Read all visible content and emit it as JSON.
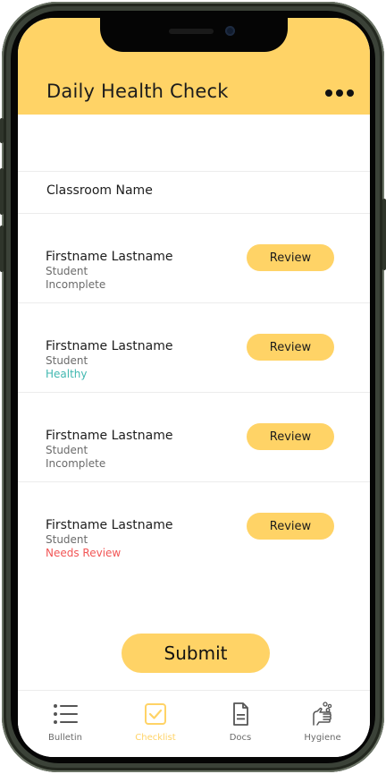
{
  "header": {
    "title": "Daily Health Check"
  },
  "classroom": {
    "name": "Classroom Name"
  },
  "students": [
    {
      "name": "Firstname Lastname",
      "role": "Student",
      "status": "Incomplete",
      "review_label": "Review"
    },
    {
      "name": "Firstname Lastname",
      "role": "Student",
      "status": "Healthy",
      "review_label": "Review"
    },
    {
      "name": "Firstname Lastname",
      "role": "Student",
      "status": "Incomplete",
      "review_label": "Review"
    },
    {
      "name": "Firstname Lastname",
      "role": "Student",
      "status": "Needs Review",
      "review_label": "Review"
    }
  ],
  "submit_label": "Submit",
  "tabs": [
    {
      "label": "Bulletin",
      "icon": "list-icon",
      "active": false
    },
    {
      "label": "Checklist",
      "icon": "checkbox-icon",
      "active": true
    },
    {
      "label": "Docs",
      "icon": "document-icon",
      "active": false
    },
    {
      "label": "Hygiene",
      "icon": "hand-wash-icon",
      "active": false
    }
  ],
  "colors": {
    "accent": "#ffd366",
    "healthy": "#41b8b0",
    "needs_review": "#f25656",
    "frame": "#3b4238"
  }
}
